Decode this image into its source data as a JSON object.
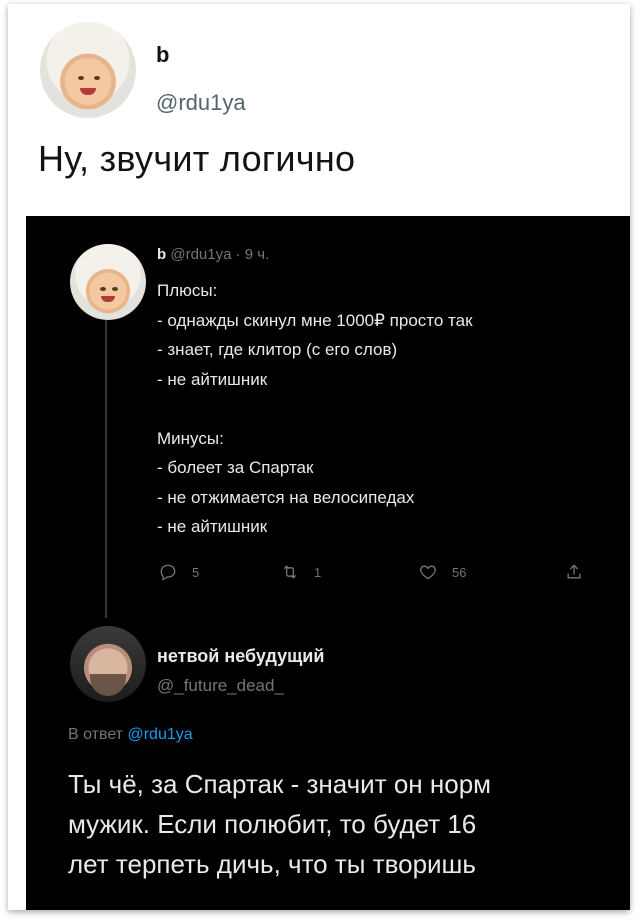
{
  "top_tweet": {
    "name": "b",
    "handle": "@rdu1ya",
    "text": "Ну, звучит логично"
  },
  "quoted_tweet": {
    "name": "b",
    "handle": "@rdu1ya",
    "time": "· 9 ч.",
    "text": "Плюсы:\n- однажды скинул мне 1000₽ просто так\n- знает, где клитор (с его слов)\n- не айтишник\n\nМинусы:\n- болеет за Спартак\n- не отжимается на велосипедах\n- не айтишник",
    "actions": {
      "replies": "5",
      "retweets": "1",
      "likes": "56"
    }
  },
  "reply_tweet": {
    "name": "нетвой небудущий",
    "handle": "@_future_dead_",
    "reply_prefix": "В ответ",
    "reply_mention": "@rdu1ya",
    "text": "Ты чё, за Спартак - значит он норм\nмужик. Если полюбит, то будет 16\nлет терпеть дичь, что ты творишь"
  },
  "colors": {
    "dark_bg": "#000000",
    "muted": "#71767b",
    "link": "#1d9bf0"
  }
}
